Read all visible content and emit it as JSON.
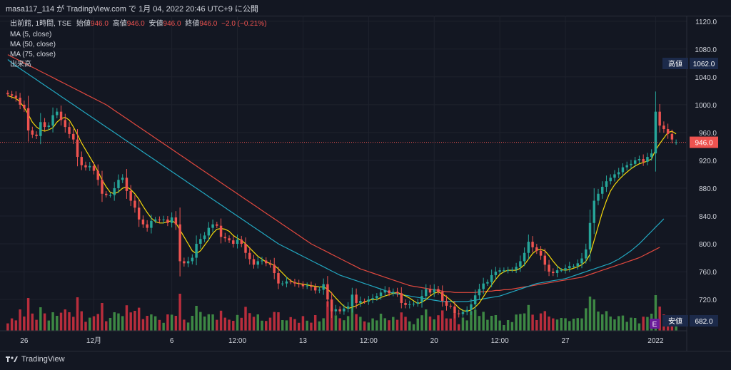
{
  "header": {
    "text": "masa117_114 が TradingView.com で 1月 04, 2022 20:46 UTC+9 に公開"
  },
  "legend": {
    "symbol": "出前館, 1時間, TSE",
    "ohlc_prefix": "始値",
    "open": "946.0",
    "high_label": "高値",
    "high": "946.0",
    "low_label": "安値",
    "low": "946.0",
    "close_label": "終値",
    "close": "946.0",
    "change": "−2.0 (−0.21%)",
    "ma5": "MA (5, close)",
    "ma50": "MA (50, close)",
    "ma75": "MA (75, close)",
    "volume": "出来高"
  },
  "footer": {
    "brand": "TradingView"
  },
  "colors": {
    "bg": "#131722",
    "up": "#26a69a",
    "down": "#ef5350",
    "vol_up": "#4caf50",
    "vol_down": "#f23645",
    "ma5": "#f5d90a",
    "ma50": "#22a7c0",
    "ma75": "#e0483e",
    "grid": "#1e222d",
    "text": "#d1d4dc"
  },
  "chart_data": {
    "type": "candlestick",
    "y_ticks": [
      "1120.0",
      "1080.0",
      "1040.0",
      "1000.0",
      "960.0",
      "920.0",
      "880.0",
      "840.0",
      "800.0",
      "760.0",
      "720.0"
    ],
    "ylim": [
      675,
      1128
    ],
    "x_ticks": [
      "26",
      "12月",
      "6",
      "12:00",
      "13",
      "12:00",
      "20",
      "12:00",
      "27",
      "2022"
    ],
    "price_labels": {
      "high": {
        "label": "高値",
        "value": "1062.0"
      },
      "last": {
        "value": "946.0"
      },
      "low": {
        "label": "安値",
        "value": "682.0"
      }
    },
    "event_marker": "E",
    "closes": [
      1015,
      1013,
      1010,
      1000,
      995,
      963,
      957,
      955,
      975,
      968,
      970,
      985,
      990,
      978,
      968,
      958,
      950,
      925,
      913,
      910,
      912,
      905,
      892,
      872,
      870,
      870,
      880,
      892,
      895,
      876,
      862,
      852,
      835,
      828,
      823,
      833,
      835,
      834,
      835,
      830,
      838,
      828,
      775,
      772,
      775,
      780,
      800,
      807,
      812,
      823,
      828,
      826,
      810,
      808,
      805,
      800,
      806,
      800,
      787,
      778,
      770,
      775,
      776,
      772,
      770,
      758,
      743,
      743,
      746,
      745,
      743,
      742,
      739,
      740,
      738,
      733,
      734,
      742,
      720,
      703,
      706,
      703,
      707,
      710,
      727,
      715,
      718,
      717,
      720,
      722,
      725,
      730,
      733,
      729,
      731,
      729,
      715,
      712,
      713,
      714,
      716,
      725,
      735,
      730,
      735,
      731,
      718,
      711,
      710,
      700,
      699,
      702,
      705,
      713,
      726,
      735,
      743,
      745,
      755,
      760,
      762,
      762,
      762,
      763,
      767,
      775,
      787,
      803,
      795,
      790,
      783,
      770,
      760,
      758,
      762,
      762,
      765,
      768,
      768,
      772,
      779,
      792,
      830,
      862,
      872,
      882,
      890,
      895,
      900,
      903,
      910,
      913,
      915,
      920,
      922,
      918,
      925,
      930,
      990,
      970,
      965,
      958,
      950,
      946
    ],
    "ma5": [
      1013,
      1011,
      1009,
      1004,
      996,
      986,
      975,
      968,
      964,
      962,
      964,
      967,
      975,
      980,
      982,
      978,
      968,
      957,
      945,
      935,
      925,
      915,
      904,
      892,
      882,
      874,
      872,
      875,
      880,
      882,
      878,
      872,
      864,
      854,
      845,
      837,
      832,
      830,
      830,
      832,
      833,
      830,
      820,
      810,
      800,
      790,
      786,
      790,
      798,
      806,
      815,
      821,
      822,
      821,
      818,
      812,
      808,
      805,
      800,
      794,
      788,
      782,
      778,
      774,
      772,
      769,
      764,
      758,
      752,
      747,
      744,
      743,
      742,
      741,
      740,
      739,
      738,
      738,
      735,
      729,
      722,
      716,
      710,
      707,
      709,
      711,
      714,
      716,
      719,
      720,
      720,
      723,
      725,
      727,
      729,
      730,
      728,
      725,
      722,
      718,
      714,
      716,
      720,
      725,
      729,
      731,
      728,
      724,
      719,
      714,
      708,
      704,
      703,
      705,
      709,
      715,
      724,
      733,
      741,
      749,
      756,
      760,
      762,
      762,
      762,
      765,
      770,
      778,
      786,
      791,
      792,
      790,
      783,
      775,
      768,
      763,
      762,
      763,
      765,
      767,
      770,
      775,
      785,
      805,
      825,
      845,
      862,
      876,
      885,
      892,
      898,
      903,
      908,
      912,
      915,
      917,
      919,
      922,
      935,
      944,
      952,
      960,
      962,
      958
    ],
    "ma50": [
      1065,
      1060,
      1056,
      1052,
      1048,
      1044,
      1040,
      1036,
      1032,
      1028,
      1024,
      1020,
      1016,
      1012,
      1008,
      1004,
      1000,
      996,
      992,
      988,
      984,
      980,
      976,
      972,
      968,
      964,
      960,
      956,
      952,
      948,
      944,
      940,
      936,
      932,
      928,
      924,
      920,
      916,
      912,
      908,
      904,
      900,
      896,
      892,
      888,
      884,
      880,
      876,
      872,
      868,
      864,
      860,
      856,
      852,
      848,
      844,
      840,
      836,
      832,
      828,
      824,
      820,
      816,
      812,
      808,
      804,
      800,
      797,
      794,
      791,
      788,
      785,
      782,
      779,
      776,
      773,
      770,
      767,
      764,
      761,
      758,
      755,
      753,
      751,
      749,
      747,
      745,
      743,
      741,
      739,
      737,
      735,
      733,
      731,
      729,
      728,
      727,
      726,
      725,
      724,
      723,
      722,
      721,
      720,
      719,
      718,
      717,
      717,
      717,
      717,
      717,
      717,
      717,
      718,
      719,
      720,
      721,
      722,
      723,
      724,
      725,
      727,
      729,
      731,
      733,
      735,
      737,
      739,
      741,
      743,
      744,
      745,
      746,
      747,
      748,
      749,
      750,
      752,
      754,
      756,
      758,
      760,
      762,
      764,
      766,
      768,
      770,
      772,
      775,
      778,
      782,
      786,
      790,
      795,
      800,
      806,
      812,
      818,
      824,
      830,
      836
    ],
    "ma75": [
      1072,
      1069,
      1066,
      1063,
      1060,
      1057,
      1054,
      1051,
      1048,
      1045,
      1042,
      1039,
      1036,
      1033,
      1030,
      1027,
      1024,
      1021,
      1018,
      1015,
      1012,
      1009,
      1006,
      1003,
      1000,
      996,
      992,
      988,
      984,
      980,
      976,
      972,
      968,
      964,
      960,
      956,
      952,
      948,
      944,
      940,
      936,
      932,
      928,
      924,
      920,
      916,
      912,
      908,
      904,
      900,
      896,
      892,
      888,
      884,
      880,
      876,
      872,
      868,
      864,
      860,
      856,
      852,
      848,
      844,
      840,
      836,
      832,
      828,
      824,
      820,
      816,
      812,
      808,
      804,
      800,
      797,
      794,
      791,
      788,
      785,
      782,
      779,
      776,
      773,
      770,
      767,
      764,
      762,
      760,
      758,
      756,
      754,
      752,
      750,
      748,
      746,
      744,
      742,
      740,
      739,
      738,
      737,
      736,
      735,
      734,
      733,
      732,
      731,
      731,
      730,
      730,
      730,
      730,
      730,
      730,
      731,
      731,
      732,
      732,
      733,
      733,
      734,
      734,
      735,
      736,
      737,
      738,
      739,
      740,
      741,
      742,
      743,
      744,
      745,
      746,
      747,
      748,
      749,
      750,
      751,
      752,
      754,
      756,
      758,
      760,
      762,
      764,
      766,
      768,
      770,
      772,
      774,
      776,
      778,
      780,
      783,
      786,
      789,
      792,
      795
    ]
  }
}
